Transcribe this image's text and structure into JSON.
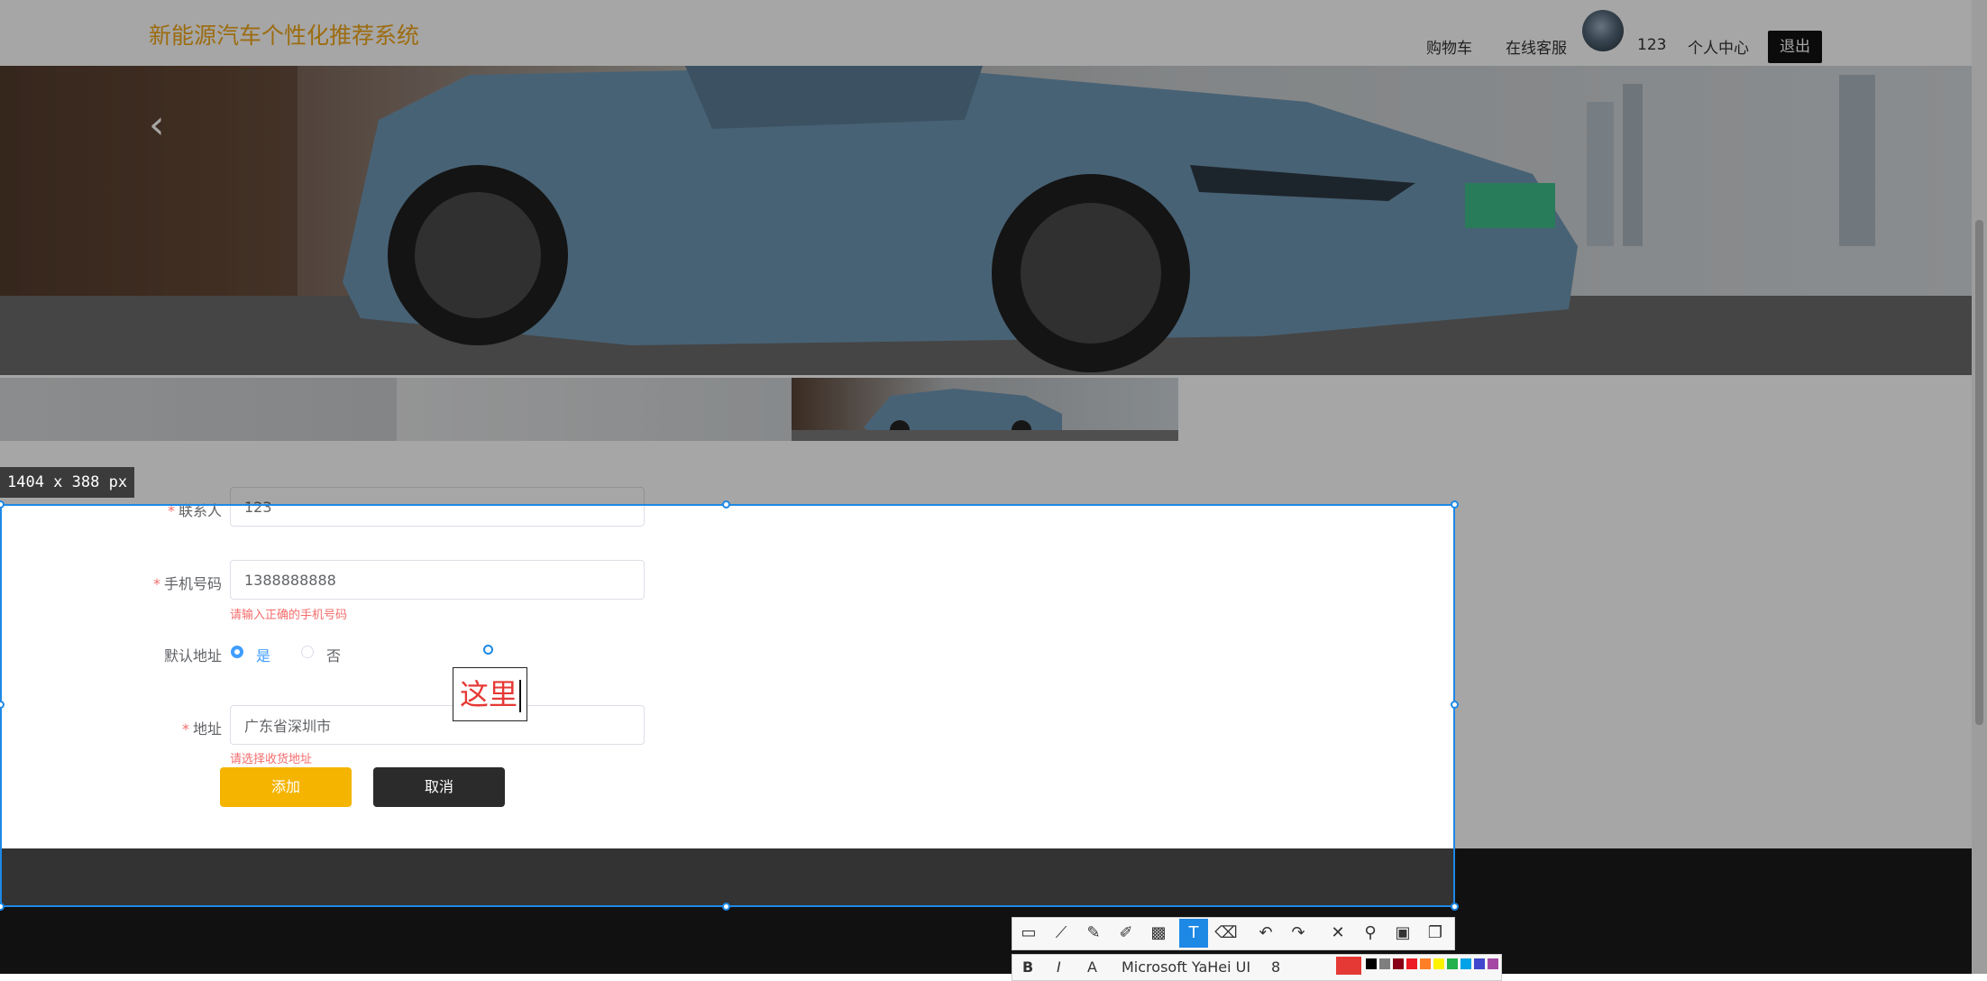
{
  "header": {
    "site_title": "新能源汽车个性化推荐系统",
    "nav": {
      "cart": "购物车",
      "service": "在线客服",
      "username": "123",
      "profile": "个人中心",
      "logout": "退出"
    }
  },
  "banner": {
    "prev_icon": "chevron-left-icon"
  },
  "form": {
    "contact": {
      "label": "联系人",
      "value": "123"
    },
    "phone": {
      "label": "手机号码",
      "value": "1388888888",
      "error": "请输入正确的手机号码"
    },
    "default": {
      "label": "默认地址",
      "options": [
        "是",
        "否"
      ],
      "selected": "是"
    },
    "address": {
      "label": "地址",
      "value": "广东省深圳市",
      "error": "请选择收货地址"
    },
    "buttons": {
      "add": "添加",
      "cancel": "取消"
    }
  },
  "screenshot_tool": {
    "size_tip": "1404 x 388 px",
    "annotation_text": "这里",
    "font_name": "Microsoft YaHei UI",
    "font_size": "8",
    "tools": [
      "rectangle-icon",
      "polyline-icon",
      "pen-icon",
      "marker-icon",
      "mosaic-icon",
      "text-icon",
      "eraser-icon",
      "undo-icon",
      "redo-icon",
      "close-icon",
      "pin-icon",
      "save-icon",
      "copy-icon"
    ],
    "active_tool": "text-icon",
    "current_color": "#e53935",
    "palette": [
      "#000000",
      "#7f7f7f",
      "#880015",
      "#ed1c24",
      "#ff7f27",
      "#fff200",
      "#22b14c",
      "#00a2e8",
      "#3f48cc",
      "#a349a4"
    ]
  },
  "colors": {
    "brand": "#f0a71a",
    "primary_button": "#f5b400",
    "dark_button": "#2b2b2b",
    "error": "#f56c6c",
    "selection": "#1e88e5"
  }
}
